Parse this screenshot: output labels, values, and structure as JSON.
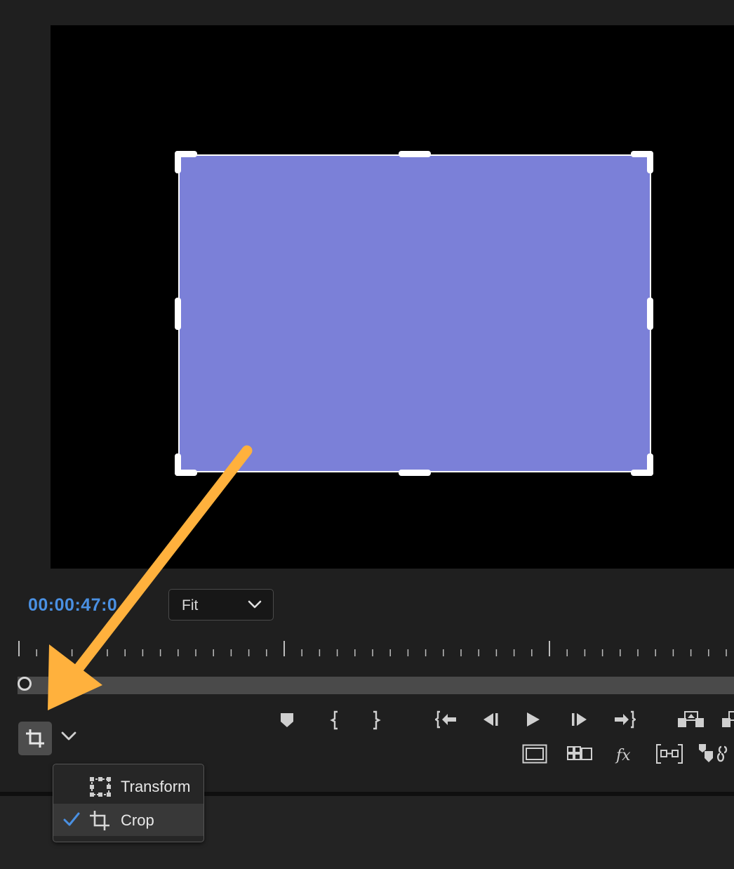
{
  "monitor": {
    "timecode": "00:00:47:0",
    "zoom": {
      "selected": "Fit"
    }
  },
  "menu": {
    "items": [
      {
        "label": "Transform",
        "icon": "transform-icon",
        "checked": false
      },
      {
        "label": "Crop",
        "icon": "crop-icon",
        "checked": true
      }
    ]
  },
  "colors": {
    "clip": "#7b80d8",
    "timecode": "#4a90e2",
    "annotation_arrow": "#ffb13d",
    "checkmark": "#4a90e2"
  }
}
